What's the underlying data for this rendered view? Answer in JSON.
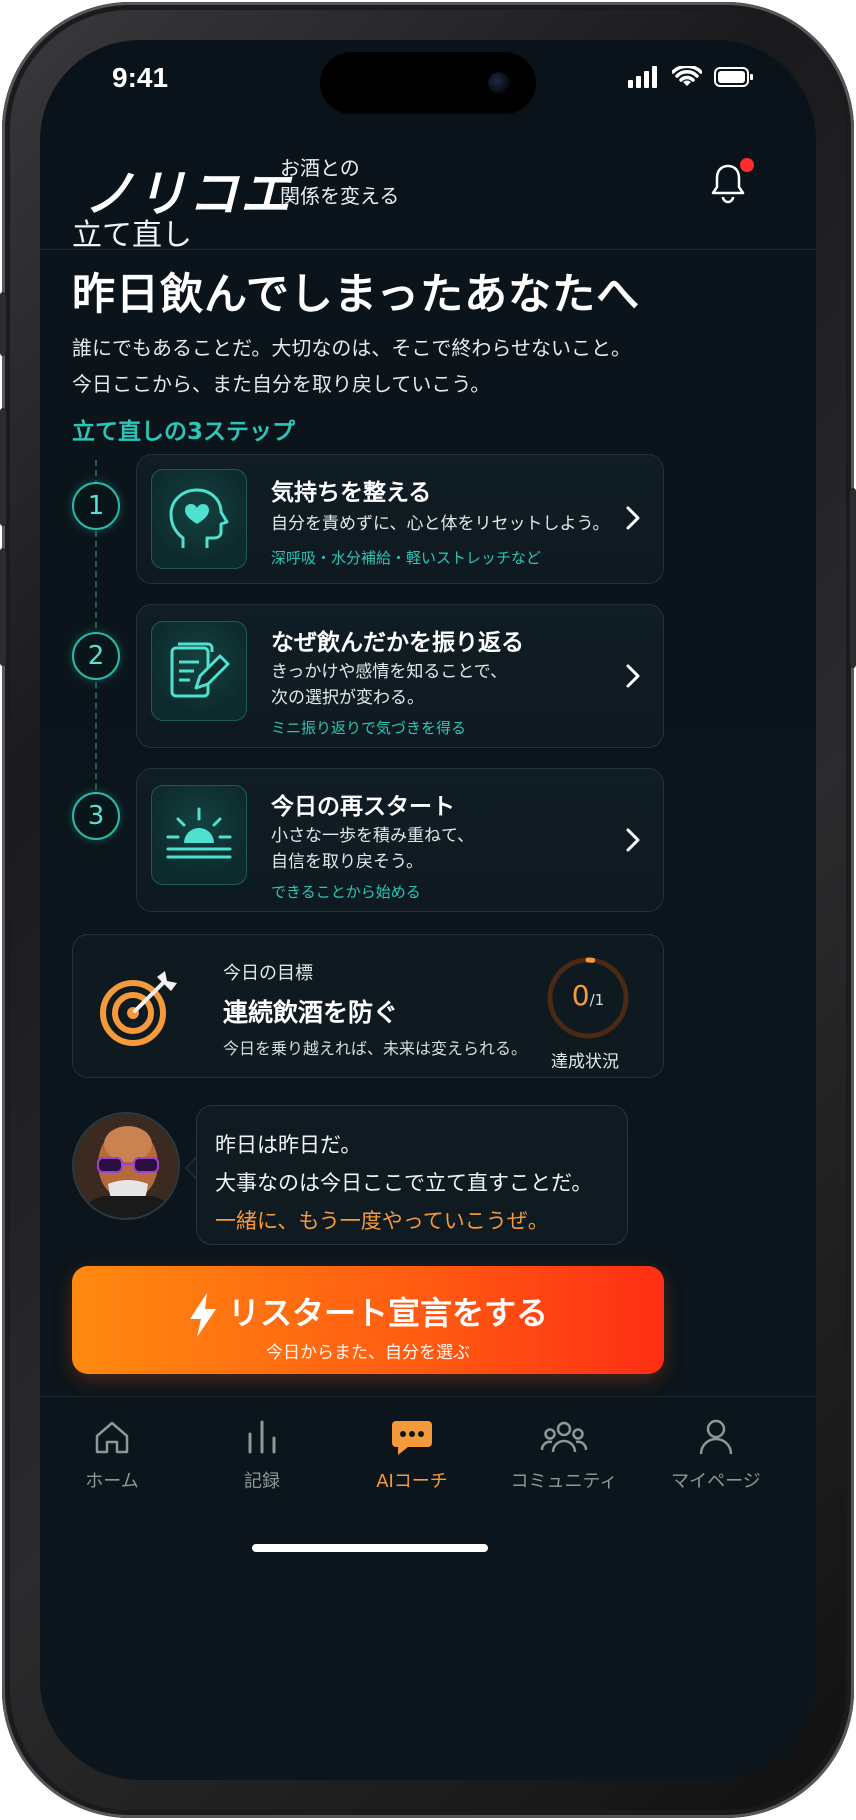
{
  "status": {
    "time": "9:41"
  },
  "header": {
    "logo": "ノリコエ",
    "tagline_line1": "お酒との",
    "tagline_line2": "関係を変える"
  },
  "hero": {
    "subtitle": "立て直し",
    "title": "昨日飲んでしまったあなたへ",
    "intro_line1": "誰にでもあることだ。大切なのは、そこで終わらせないこと。",
    "intro_line2": "今日ここから、また自分を取り戻していこう。"
  },
  "steps_section": {
    "label": "立て直しの3ステップ",
    "steps": [
      {
        "number": "1",
        "title": "気持ちを整える",
        "desc_line1": "自分を責めずに、心と体をリセットしよう。",
        "desc_line2": "",
        "hint": "深呼吸・水分補給・軽いストレッチなど",
        "icon": "heart-head-icon"
      },
      {
        "number": "2",
        "title": "なぜ飲んだかを振り返る",
        "desc_line1": "きっかけや感情を知ることで、",
        "desc_line2": "次の選択が変わる。",
        "hint": "ミニ振り返りで気づきを得る",
        "icon": "notes-pencil-icon"
      },
      {
        "number": "3",
        "title": "今日の再スタート",
        "desc_line1": "小さな一歩を積み重ねて、",
        "desc_line2": "自信を取り戻そう。",
        "hint": "できることから始める",
        "icon": "sunrise-icon"
      }
    ]
  },
  "goal": {
    "label": "今日の目標",
    "title": "連続飲酒を防ぐ",
    "desc": "今日を乗り越えれば、未来は変えられる。",
    "progress_value": "0",
    "progress_total": "/1",
    "progress_fraction": 0,
    "status_label": "達成状況"
  },
  "coach": {
    "line1": "昨日は昨日だ。",
    "line2": "大事なのは今日ここで立て直すことだ。",
    "line3": "一緒に、もう一度やっていこうぜ。"
  },
  "cta": {
    "label": "リスタート宣言をする",
    "sublabel": "今日からまた、自分を選ぶ"
  },
  "tabbar": {
    "items": [
      {
        "label": "ホーム",
        "icon": "home-icon"
      },
      {
        "label": "記録",
        "icon": "bar-chart-icon"
      },
      {
        "label": "AIコーチ",
        "icon": "chat-bubble-icon",
        "active": true
      },
      {
        "label": "コミュニティ",
        "icon": "people-icon"
      },
      {
        "label": "マイページ",
        "icon": "person-icon"
      }
    ]
  },
  "colors": {
    "accent_teal": "#2ec4b6",
    "accent_orange": "#f59a3a",
    "cta_start": "#ff8a10",
    "cta_end": "#ff2e14",
    "background": "#0b151b"
  }
}
